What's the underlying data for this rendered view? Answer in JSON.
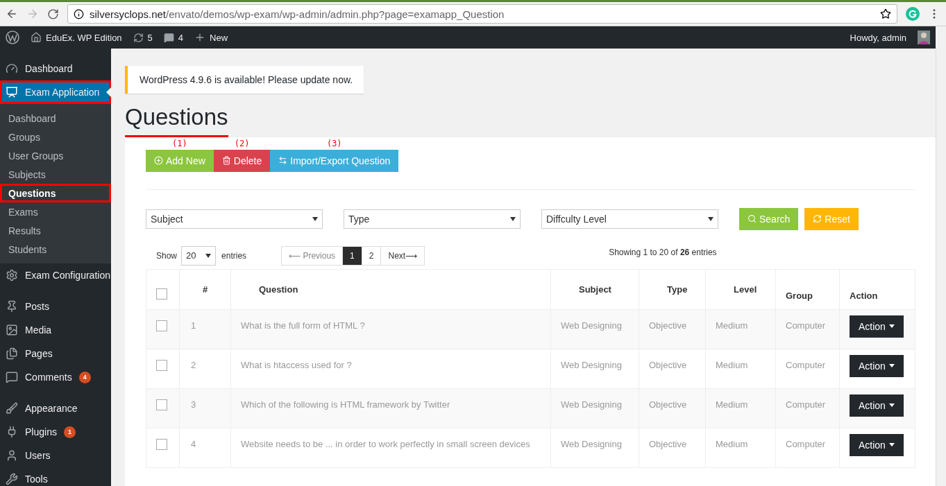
{
  "browser": {
    "url_host": "silversyclops.net",
    "url_path": "/envato/demos/wp-exam/wp-admin/admin.php?page=examapp_Question",
    "forward_disabled": true
  },
  "admin_bar": {
    "site": "EduEx. WP Edition",
    "updates": "5",
    "comments": "4",
    "new": "New",
    "greeting": "Howdy, admin"
  },
  "sidebar": {
    "groups": [
      {
        "items": [
          {
            "label": "Dashboard",
            "selected": false,
            "highlighted": false
          },
          {
            "label": "Exam Application",
            "selected": true,
            "highlighted": true,
            "children": [
              {
                "label": "Dashboard",
                "selected": false,
                "highlighted": false
              },
              {
                "label": "Groups",
                "selected": false,
                "highlighted": false
              },
              {
                "label": "User Groups",
                "selected": false,
                "highlighted": false
              },
              {
                "label": "Subjects",
                "selected": false,
                "highlighted": false
              },
              {
                "label": "Questions",
                "selected": true,
                "highlighted": true
              },
              {
                "label": "Exams",
                "selected": false,
                "highlighted": false
              },
              {
                "label": "Results",
                "selected": false,
                "highlighted": false
              },
              {
                "label": "Students",
                "selected": false,
                "highlighted": false
              }
            ]
          },
          {
            "label": "Exam Configuration",
            "selected": false,
            "highlighted": false
          }
        ]
      },
      {
        "items": [
          {
            "label": "Posts",
            "selected": false,
            "highlighted": false
          },
          {
            "label": "Media",
            "selected": false,
            "highlighted": false
          },
          {
            "label": "Pages",
            "selected": false,
            "highlighted": false
          },
          {
            "label": "Comments",
            "selected": false,
            "highlighted": false,
            "badge": "4"
          }
        ]
      },
      {
        "items": [
          {
            "label": "Appearance",
            "selected": false,
            "highlighted": false
          },
          {
            "label": "Plugins",
            "selected": false,
            "highlighted": false,
            "badge": "1"
          },
          {
            "label": "Users",
            "selected": false,
            "highlighted": false
          },
          {
            "label": "Tools",
            "selected": false,
            "highlighted": false
          }
        ]
      }
    ]
  },
  "notice": "WordPress 4.9.6 is available! Please update now.",
  "page_title": "Questions",
  "actions": [
    {
      "kind": "add",
      "label": "Add New",
      "annotation": "(1)"
    },
    {
      "kind": "delete",
      "label": "Delete",
      "annotation": "(2)"
    },
    {
      "kind": "import",
      "label": "Import/Export Question",
      "annotation": "(3)"
    }
  ],
  "filters": [
    {
      "value": "Subject"
    },
    {
      "value": "Type"
    },
    {
      "value": "Diffculty Level"
    }
  ],
  "filter_buttons": [
    {
      "kind": "search",
      "label": "Search"
    },
    {
      "kind": "reset",
      "label": "Reset"
    }
  ],
  "length": {
    "before": "Show",
    "value": "20",
    "after": "entries"
  },
  "pagination": [
    {
      "label": "⟵ Previous",
      "selected": false,
      "disabled": true
    },
    {
      "label": "1",
      "selected": true,
      "disabled": false
    },
    {
      "label": "2",
      "selected": false,
      "disabled": false
    },
    {
      "label": "Next⟶",
      "selected": false,
      "disabled": false
    }
  ],
  "info": "Showing 1 to 20 of **26** entries",
  "table": {
    "header_checked": false,
    "columns": [
      "#",
      "Question",
      "Subject",
      "Type",
      "Level",
      "Group",
      "Action"
    ],
    "rows": [
      {
        "checked": false,
        "number": "1",
        "question": "What is the full form of HTML ?",
        "subject": "Web Designing",
        "type": "Objective",
        "level": "Medium",
        "group": "Computer",
        "action": "Action"
      },
      {
        "checked": false,
        "number": "2",
        "question": "What is htaccess used for ?",
        "subject": "Web Designing",
        "type": "Objective",
        "level": "Medium",
        "group": "Computer",
        "action": "Action"
      },
      {
        "checked": false,
        "number": "3",
        "question": "Which of the following is HTML framework by Twitter",
        "subject": "Web Designing",
        "type": "Objective",
        "level": "Medium",
        "group": "Computer",
        "action": "Action"
      },
      {
        "checked": false,
        "number": "4",
        "question": "Website needs to be ... in order to work perfectly in small screen devices",
        "subject": "Web Designing",
        "type": "Objective",
        "level": "Medium",
        "group": "Computer",
        "action": "Action"
      }
    ]
  }
}
